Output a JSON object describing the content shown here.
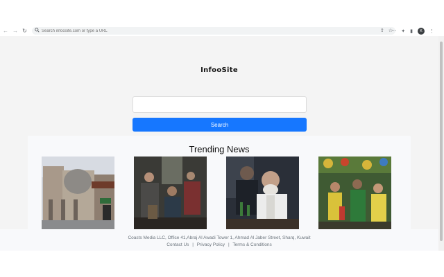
{
  "browser": {
    "nav": {
      "back": "←",
      "forward": "→",
      "reload": "↻"
    },
    "omnibox": {
      "placeholder": "Search infoosite.com or type a URL"
    },
    "profile_initial": "K"
  },
  "page": {
    "logo": "InfooSite",
    "search": {
      "placeholder": "",
      "button_label": "Search"
    },
    "trending": {
      "title": "Trending News",
      "cards": [
        {
          "alt": "building with dome"
        },
        {
          "alt": "people in train car"
        },
        {
          "alt": "man speaking"
        },
        {
          "alt": "crowd celebrating"
        }
      ]
    },
    "footer": {
      "address": "Coasts Media LLC, Office 41,Abraj Al Awadi Tower 1, Ahmad Al Jaber Street, Sharq, Kuwait",
      "links": [
        "Contact Us",
        "Privacy Policy",
        "Terms & Conditions"
      ]
    }
  },
  "colors": {
    "accent": "#1677ff",
    "page_bg": "#f4f4f4"
  }
}
